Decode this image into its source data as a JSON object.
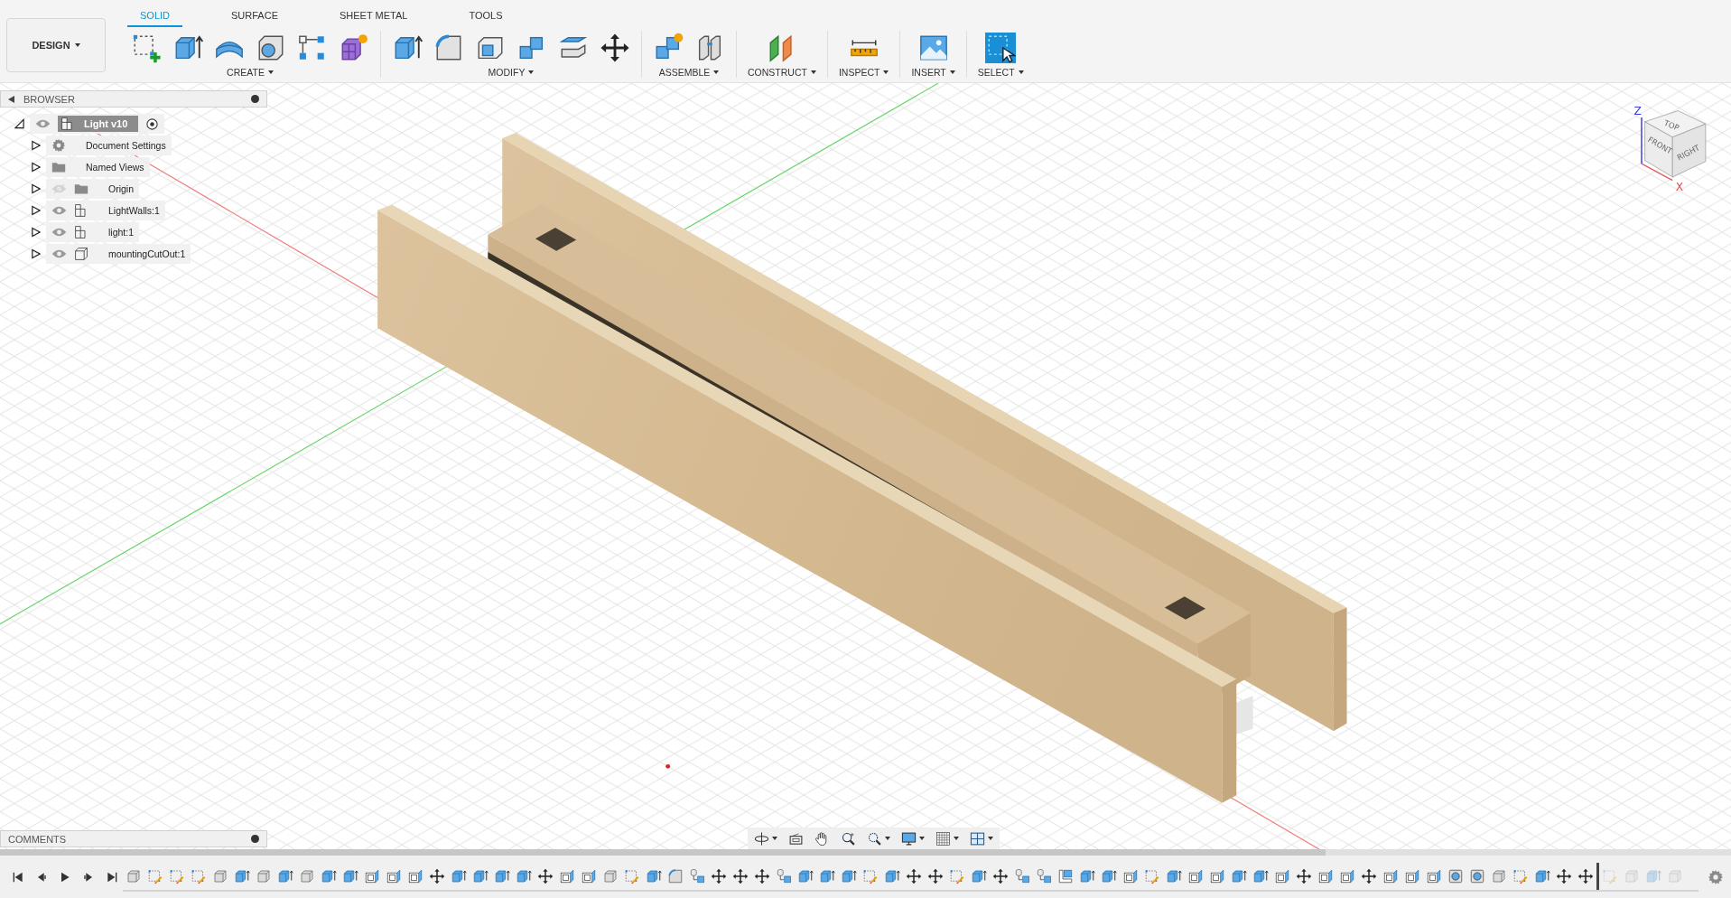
{
  "workspace": {
    "label": "DESIGN"
  },
  "tabs": [
    {
      "label": "SOLID",
      "selected": true
    },
    {
      "label": "SURFACE",
      "selected": false
    },
    {
      "label": "SHEET METAL",
      "selected": false
    },
    {
      "label": "TOOLS",
      "selected": false
    }
  ],
  "toolbar_groups": [
    {
      "label": "CREATE",
      "tools": [
        {
          "kind": "sketch"
        },
        {
          "kind": "extrude"
        },
        {
          "kind": "revolve"
        },
        {
          "kind": "hole"
        },
        {
          "kind": "pattern"
        },
        {
          "kind": "form"
        }
      ]
    },
    {
      "label": "MODIFY",
      "tools": [
        {
          "kind": "presspull"
        },
        {
          "kind": "fillet"
        },
        {
          "kind": "shell"
        },
        {
          "kind": "combine"
        },
        {
          "kind": "offset"
        },
        {
          "kind": "move"
        }
      ]
    },
    {
      "label": "ASSEMBLE",
      "tools": [
        {
          "kind": "newcomponent"
        },
        {
          "kind": "joint"
        }
      ]
    },
    {
      "label": "CONSTRUCT",
      "tools": [
        {
          "kind": "plane"
        }
      ]
    },
    {
      "label": "INSPECT",
      "tools": [
        {
          "kind": "measure"
        }
      ]
    },
    {
      "label": "INSERT",
      "tools": [
        {
          "kind": "image"
        }
      ]
    },
    {
      "label": "SELECT",
      "tools": [
        {
          "kind": "select"
        }
      ]
    }
  ],
  "browser": {
    "title": "BROWSER",
    "root": {
      "label": "Light v10",
      "expanded": true,
      "visible": true,
      "active": true,
      "children": [
        {
          "label": "Document Settings",
          "kind": "settings",
          "expanded": false
        },
        {
          "label": "Named Views",
          "kind": "folder",
          "expanded": false
        },
        {
          "label": "Origin",
          "kind": "folder",
          "expanded": false,
          "visible": false
        },
        {
          "label": "LightWalls:1",
          "kind": "component",
          "expanded": false,
          "visible": true
        },
        {
          "label": "light:1",
          "kind": "component",
          "expanded": false,
          "visible": true
        },
        {
          "label": "mountingCutOut:1",
          "kind": "body",
          "expanded": false,
          "visible": true
        }
      ]
    }
  },
  "comments": {
    "title": "COMMENTS"
  },
  "view_cube": {
    "top": "TOP",
    "front": "FRONT",
    "right": "RIGHT",
    "z_axis": "Z",
    "x_axis": "X"
  },
  "nav_tools": [
    {
      "kind": "orbit",
      "dropdown": true
    },
    {
      "kind": "lookat",
      "dropdown": false
    },
    {
      "kind": "pan",
      "dropdown": false
    },
    {
      "kind": "zoom",
      "dropdown": false
    },
    {
      "kind": "fit",
      "dropdown": true
    },
    {
      "kind": "display",
      "dropdown": true
    },
    {
      "kind": "grid",
      "dropdown": true
    },
    {
      "kind": "viewports",
      "dropdown": true
    }
  ],
  "playback": [
    {
      "kind": "first"
    },
    {
      "kind": "prev"
    },
    {
      "kind": "play"
    },
    {
      "kind": "next"
    },
    {
      "kind": "last"
    }
  ],
  "timeline": {
    "features": [
      {
        "kind": "box",
        "rolled_back": false
      },
      {
        "kind": "sketch",
        "rolled_back": false
      },
      {
        "kind": "sketch",
        "rolled_back": false
      },
      {
        "kind": "sketch",
        "rolled_back": false
      },
      {
        "kind": "box",
        "rolled_back": false
      },
      {
        "kind": "extrude",
        "rolled_back": false
      },
      {
        "kind": "box",
        "rolled_back": false
      },
      {
        "kind": "extrude",
        "rolled_back": false
      },
      {
        "kind": "box",
        "rolled_back": false
      },
      {
        "kind": "extrude",
        "rolled_back": false
      },
      {
        "kind": "extrude",
        "rolled_back": false
      },
      {
        "kind": "shell",
        "rolled_back": false
      },
      {
        "kind": "shell",
        "rolled_back": false
      },
      {
        "kind": "shell",
        "rolled_back": false
      },
      {
        "kind": "move",
        "rolled_back": false
      },
      {
        "kind": "extrude",
        "rolled_back": false
      },
      {
        "kind": "extrude",
        "rolled_back": false
      },
      {
        "kind": "extrude",
        "rolled_back": false
      },
      {
        "kind": "extrude",
        "rolled_back": false
      },
      {
        "kind": "move",
        "rolled_back": false
      },
      {
        "kind": "shell",
        "rolled_back": false
      },
      {
        "kind": "shell",
        "rolled_back": false
      },
      {
        "kind": "box",
        "rolled_back": false
      },
      {
        "kind": "sketch",
        "rolled_back": false
      },
      {
        "kind": "extrude",
        "rolled_back": false
      },
      {
        "kind": "fillet",
        "rolled_back": false
      },
      {
        "kind": "combine",
        "rolled_back": false
      },
      {
        "kind": "move",
        "rolled_back": false
      },
      {
        "kind": "move",
        "rolled_back": false
      },
      {
        "kind": "move",
        "rolled_back": false
      },
      {
        "kind": "combine",
        "rolled_back": false
      },
      {
        "kind": "extrude",
        "rolled_back": false
      },
      {
        "kind": "extrude",
        "rolled_back": false
      },
      {
        "kind": "extrude",
        "rolled_back": false
      },
      {
        "kind": "sketch",
        "rolled_back": false
      },
      {
        "kind": "extrude",
        "rolled_back": false
      },
      {
        "kind": "move",
        "rolled_back": false
      },
      {
        "kind": "move",
        "rolled_back": false
      },
      {
        "kind": "sketch",
        "rolled_back": false
      },
      {
        "kind": "extrude",
        "rolled_back": false
      },
      {
        "kind": "move",
        "rolled_back": false
      },
      {
        "kind": "combine",
        "rolled_back": false
      },
      {
        "kind": "combine",
        "rolled_back": false
      },
      {
        "kind": "joint",
        "rolled_back": false
      },
      {
        "kind": "extrude",
        "rolled_back": false
      },
      {
        "kind": "extrude",
        "rolled_back": false
      },
      {
        "kind": "shell",
        "rolled_back": false
      },
      {
        "kind": "sketch",
        "rolled_back": false
      },
      {
        "kind": "extrude",
        "rolled_back": false
      },
      {
        "kind": "shell",
        "rolled_back": false
      },
      {
        "kind": "shell",
        "rolled_back": false
      },
      {
        "kind": "extrude",
        "rolled_back": false
      },
      {
        "kind": "extrude",
        "rolled_back": false
      },
      {
        "kind": "shell",
        "rolled_back": false
      },
      {
        "kind": "move",
        "rolled_back": false
      },
      {
        "kind": "shell",
        "rolled_back": false
      },
      {
        "kind": "shell",
        "rolled_back": false
      },
      {
        "kind": "move",
        "rolled_back": false
      },
      {
        "kind": "shell",
        "rolled_back": false
      },
      {
        "kind": "shell",
        "rolled_back": false
      },
      {
        "kind": "shell",
        "rolled_back": false
      },
      {
        "kind": "hole",
        "rolled_back": false
      },
      {
        "kind": "hole",
        "rolled_back": false
      },
      {
        "kind": "box",
        "rolled_back": false
      },
      {
        "kind": "sketch",
        "rolled_back": false
      },
      {
        "kind": "extrude",
        "rolled_back": false
      },
      {
        "kind": "move",
        "rolled_back": false
      },
      {
        "kind": "move",
        "rolled_back": false
      },
      {
        "kind": "sketch",
        "rolled_back": true
      },
      {
        "kind": "box",
        "rolled_back": true
      },
      {
        "kind": "extrude",
        "rolled_back": true
      },
      {
        "kind": "box",
        "rolled_back": true
      }
    ]
  }
}
